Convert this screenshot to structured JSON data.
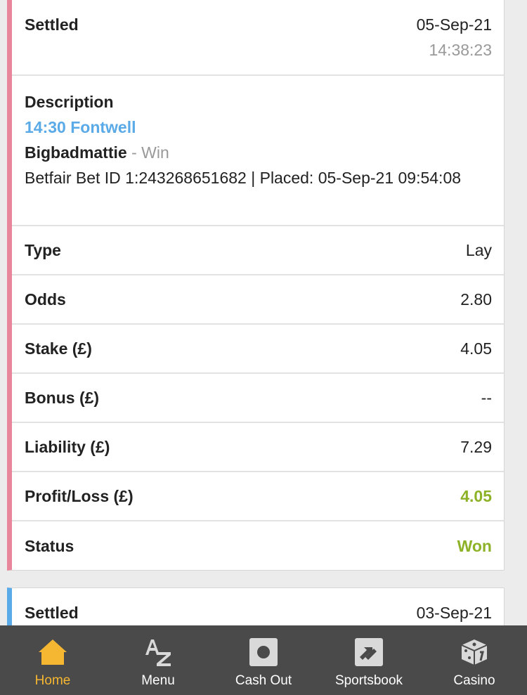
{
  "bet1": {
    "status_label": "Settled",
    "date": "05-Sep-21",
    "time": "14:38:23",
    "description_label": "Description",
    "event": "14:30 Fontwell",
    "runner": "Bigbadmattie",
    "separator": " - ",
    "market": "Win",
    "bet_info": "Betfair Bet ID 1:243268651682 | Placed: 05-Sep-21 09:54:08",
    "accent_color": "#e8879c",
    "rows": [
      {
        "label": "Type",
        "value": "Lay"
      },
      {
        "label": "Odds",
        "value": "2.80"
      },
      {
        "label": "Stake (£)",
        "value": "4.05"
      },
      {
        "label": "Bonus (£)",
        "value": "--"
      },
      {
        "label": "Liability (£)",
        "value": "7.29"
      },
      {
        "label": "Profit/Loss (£)",
        "value": "4.05"
      },
      {
        "label": "Status",
        "value": "Won"
      }
    ]
  },
  "bet2": {
    "status_label": "Settled",
    "date": "03-Sep-21",
    "accent_color": "#5aaae8"
  },
  "nav": {
    "items": [
      {
        "label": "Home",
        "icon": "home-icon",
        "active": true
      },
      {
        "label": "Menu",
        "icon": "az-icon"
      },
      {
        "label": "Cash Out",
        "icon": "cash-out-icon"
      },
      {
        "label": "Sportsbook",
        "icon": "sportsbook-icon"
      },
      {
        "label": "Casino",
        "icon": "dice-icon"
      }
    ],
    "active_color": "#f5b731"
  },
  "colors": {
    "positive": "#8db227",
    "link": "#5aaae8"
  }
}
